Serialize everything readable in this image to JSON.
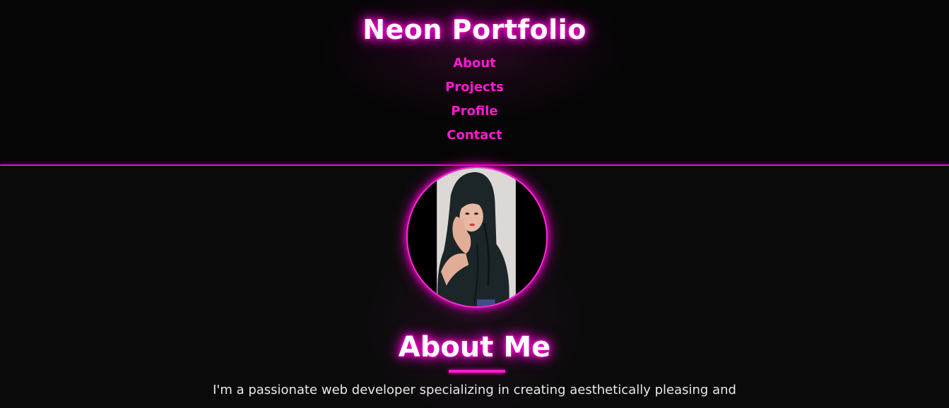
{
  "header": {
    "title": "Neon Portfolio",
    "nav": [
      {
        "label": "About"
      },
      {
        "label": "Projects"
      },
      {
        "label": "Profile"
      },
      {
        "label": "Contact"
      }
    ]
  },
  "about": {
    "heading": "About Me",
    "text": "I'm a passionate web developer specializing in creating aesthetically pleasing and"
  },
  "colors": {
    "accent": "#ff1ad4",
    "background": "#0a0a0a",
    "text": "#ffffff"
  }
}
